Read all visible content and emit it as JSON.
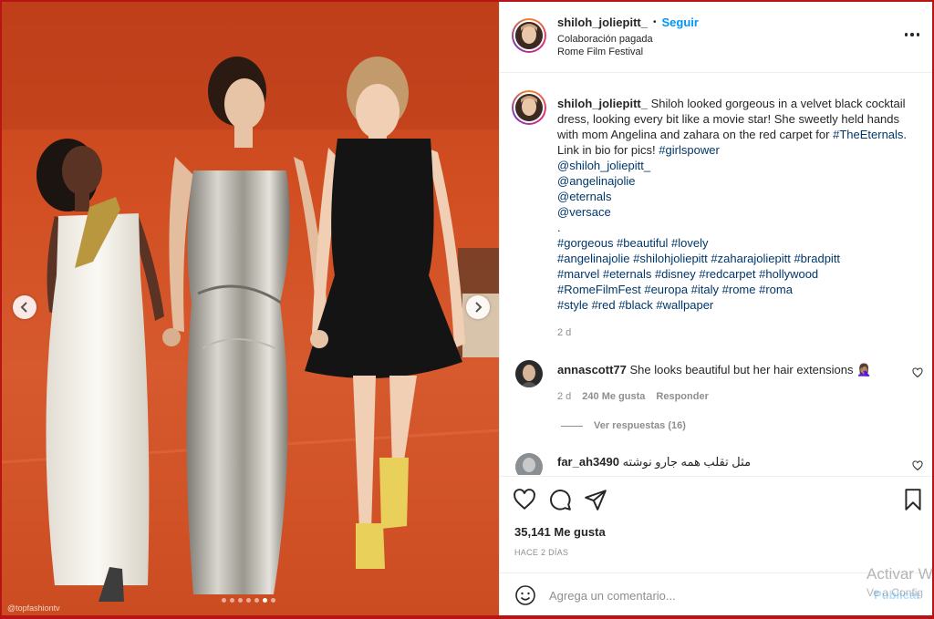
{
  "post": {
    "username": "shiloh_joliepitt_",
    "separator": "•",
    "follow_label": "Seguir",
    "paid_partnership": "Colaboración pagada",
    "location": "Rome Film Festival"
  },
  "media": {
    "watermark": "@topfashiontv",
    "carousel_total": 7,
    "carousel_active_index": 5
  },
  "caption": {
    "username": "shiloh_joliepitt_",
    "text": "Shiloh looked gorgeous in a velvet black cocktail dress, looking every bit like a movie star! She sweetly held hands with mom Angelina and zahara on the red carpet for",
    "hashtag_event": "#TheEternals",
    "text2": ". Link in bio for pics!",
    "hashtag_girlspower": "#girlspower",
    "mentions": [
      "@shiloh_joliepitt_",
      "@angelinajolie",
      "@eternals",
      "@versace"
    ],
    "dot": ".",
    "hashtag_lines": [
      "#gorgeous #beautiful #lovely",
      "#angelinajolie #shilohjoliepitt #zaharajoliepitt #bradpitt",
      "#marvel #eternals #disney #redcarpet #hollywood",
      "#RomeFilmFest #europa #italy #rome #roma",
      "#style #red #black #wallpaper"
    ],
    "age": "2 d"
  },
  "comments": [
    {
      "username": "annascott77",
      "text": "She looks beautiful but her hair extensions 🤦🏽‍♀️",
      "age": "2 d",
      "likes": "240 Me gusta",
      "reply_label": "Responder",
      "view_replies": "Ver respuestas (16)"
    },
    {
      "username": "far_ah3490",
      "text": "مثل تقلب همه جارو نوشته"
    }
  ],
  "actions": {
    "likes_count": "35,141 Me gusta",
    "timestamp": "HACE 2 DÍAS"
  },
  "composer": {
    "placeholder": "Agrega un comentario...",
    "publish_label": "Publicar"
  },
  "os_overlay": {
    "activate_line1": "Activar W",
    "activate_line2": "Ve a Config"
  },
  "colors": {
    "accent": "#0095f6",
    "link": "#00376b",
    "secondary_text": "#8e8e8e",
    "red_carpet": "#d14e22",
    "outer_frame": "#b81414"
  }
}
